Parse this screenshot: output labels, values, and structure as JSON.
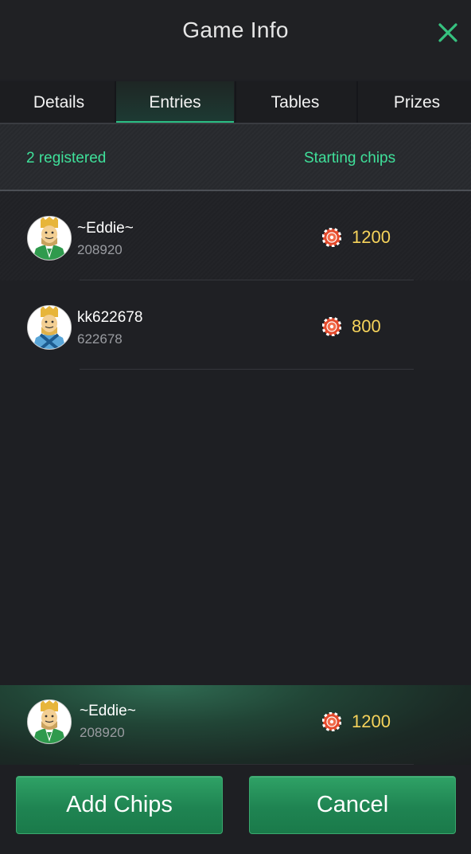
{
  "header": {
    "title": "Game Info",
    "close_icon": "close-icon"
  },
  "tabs": [
    {
      "label": "Details",
      "active": false
    },
    {
      "label": "Entries",
      "active": true
    },
    {
      "label": "Tables",
      "active": false
    },
    {
      "label": "Prizes",
      "active": false
    }
  ],
  "summary": {
    "registered": "2 registered",
    "starting_chips_label": "Starting chips"
  },
  "players": [
    {
      "name": "~Eddie~",
      "id": "208920",
      "chips": "1200",
      "avatar": "king-green-avatar"
    },
    {
      "name": "kk622678",
      "id": "622678",
      "chips": "800",
      "avatar": "king-blue-avatar"
    }
  ],
  "me": {
    "name": "~Eddie~",
    "id": "208920",
    "chips": "1200",
    "avatar": "king-green-avatar"
  },
  "buttons": {
    "add_chips": "Add Chips",
    "cancel": "Cancel"
  },
  "colors": {
    "accent": "#3fe09a",
    "chips": "#f6d35b",
    "button": "#1f8452"
  }
}
